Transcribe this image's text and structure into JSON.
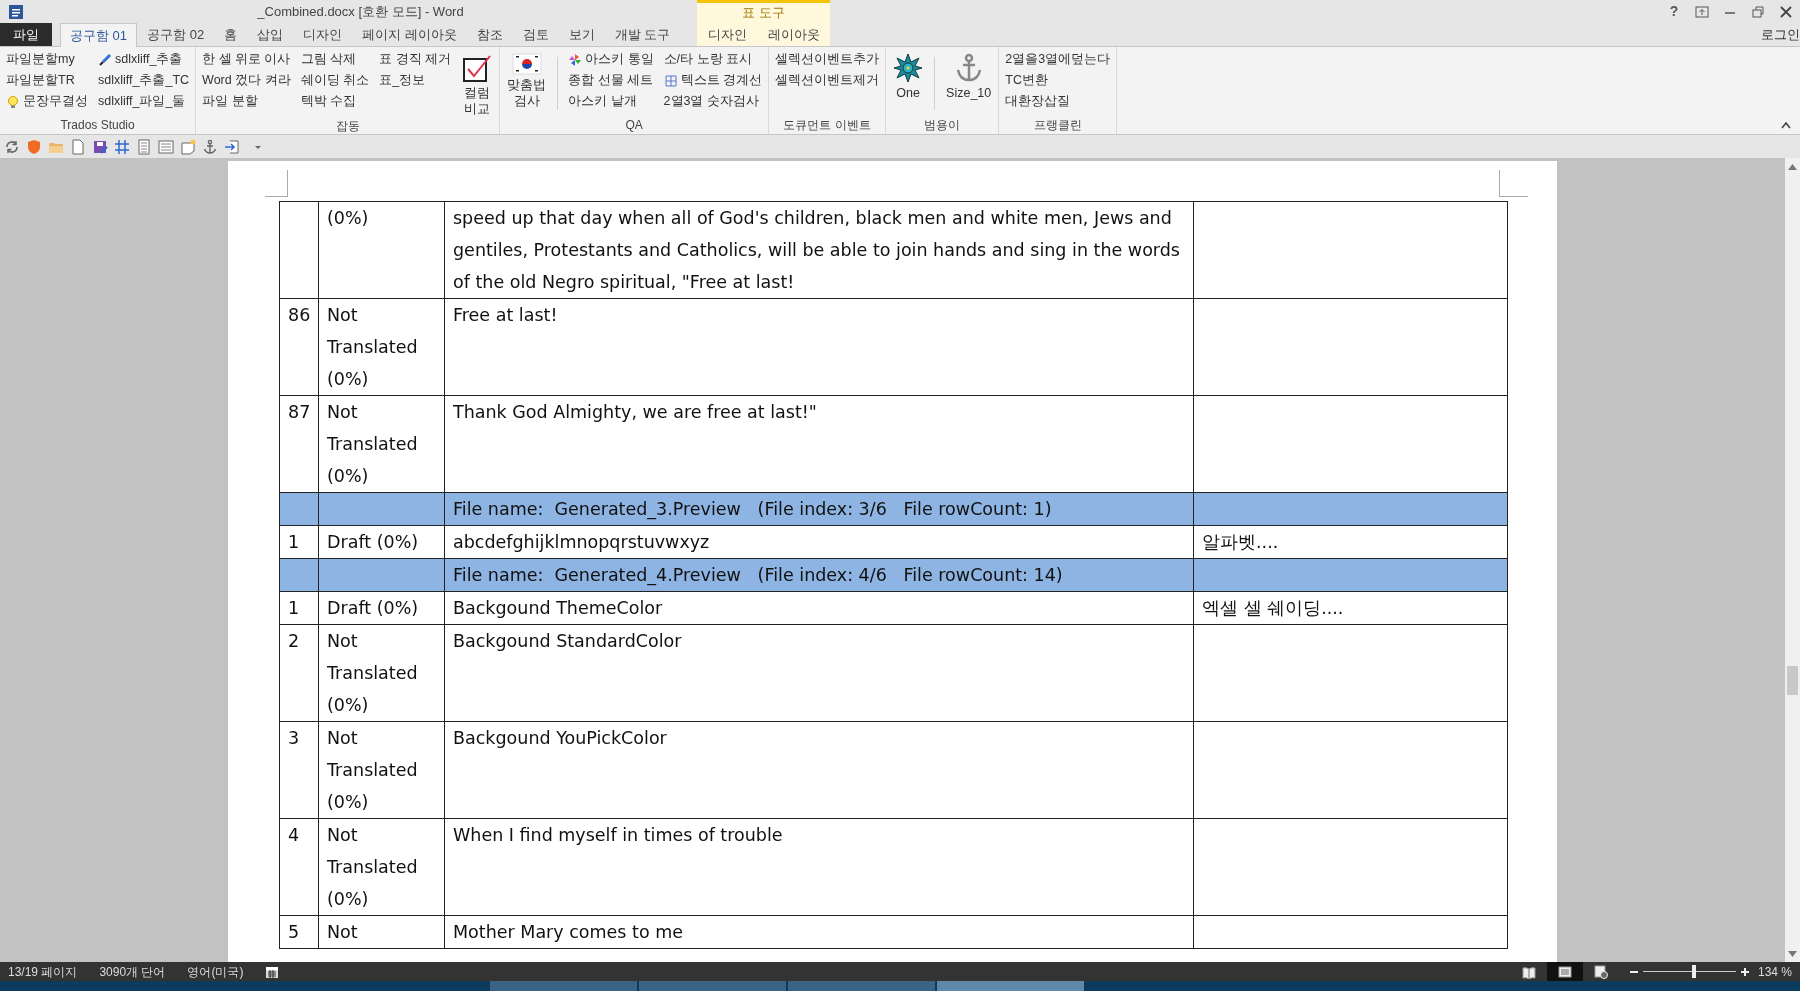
{
  "window": {
    "title": "_Combined.docx [호환 모드] - Word",
    "help": "?",
    "account": "로그인"
  },
  "tabs": [
    {
      "label": "파일",
      "kind": "file",
      "selected": false
    },
    {
      "label": "공구함 01",
      "kind": "tab",
      "selected": true
    },
    {
      "label": "공구함 02",
      "kind": "tab",
      "selected": false
    },
    {
      "label": "홈",
      "kind": "tab",
      "selected": false
    },
    {
      "label": "삽입",
      "kind": "tab",
      "selected": false
    },
    {
      "label": "디자인",
      "kind": "tab",
      "selected": false
    },
    {
      "label": "페이지 레이아웃",
      "kind": "tab",
      "selected": false
    },
    {
      "label": "참조",
      "kind": "tab",
      "selected": false
    },
    {
      "label": "검토",
      "kind": "tab",
      "selected": false
    },
    {
      "label": "보기",
      "kind": "tab",
      "selected": false
    },
    {
      "label": "개발 도구",
      "kind": "tab",
      "selected": false
    }
  ],
  "context_tabs": {
    "title": "표 도구",
    "tabs": [
      {
        "label": "디자인",
        "selected": false
      },
      {
        "label": "레이아웃",
        "selected": false
      }
    ]
  },
  "ribbon": [
    {
      "label": "Trados Studio",
      "blocks": [
        {
          "kind": "column",
          "buttons": [
            {
              "label": "파일분할my"
            },
            {
              "label": "파일분할TR"
            },
            {
              "label": "문장무결성"
            }
          ]
        },
        {
          "kind": "column",
          "buttons": [
            {
              "label": "sdlxliff_추출"
            },
            {
              "label": "sdlxliff_추출_TC"
            },
            {
              "label": "sdlxliff_파일_둘"
            }
          ]
        }
      ]
    },
    {
      "label": "잡동",
      "blocks": [
        {
          "kind": "column",
          "buttons": [
            {
              "label": "한 셀 위로 이사"
            },
            {
              "label": "Word 껐다 켜라"
            },
            {
              "label": "파일 분할"
            }
          ]
        },
        {
          "kind": "column",
          "buttons": [
            {
              "label": "그림 삭제"
            },
            {
              "label": "쉐이딩 취소"
            },
            {
              "label": "텍박 수집"
            }
          ]
        },
        {
          "kind": "column",
          "buttons": [
            {
              "label": "표 경직 제거"
            },
            {
              "label": "표_정보"
            }
          ]
        },
        {
          "kind": "large",
          "label": "컬럼 비교"
        }
      ]
    },
    {
      "label": "QA",
      "blocks": [
        {
          "kind": "large",
          "label": "맞춤법 검사"
        },
        {
          "kind": "separator"
        },
        {
          "kind": "column",
          "buttons": [
            {
              "label": "아스키 통일"
            },
            {
              "label": "종합 선물 세트"
            },
            {
              "label": "아스키 낱개"
            }
          ]
        },
        {
          "kind": "column",
          "buttons": [
            {
              "label": "소/타 노랑 표시"
            },
            {
              "label": "텍스트 경계선"
            },
            {
              "label": "2열3열 숫자검사"
            }
          ]
        }
      ]
    },
    {
      "label": "도큐먼트 이벤트",
      "blocks": [
        {
          "kind": "column",
          "buttons": [
            {
              "label": "셀렉션이벤트추가"
            },
            {
              "label": "셀렉션이벤트제거"
            }
          ]
        }
      ]
    },
    {
      "label": "범용이",
      "blocks": [
        {
          "kind": "large",
          "label": "One"
        },
        {
          "kind": "separator"
        },
        {
          "kind": "large",
          "label": "Size_10"
        }
      ]
    },
    {
      "label": "프랭클린",
      "blocks": [
        {
          "kind": "column",
          "buttons": [
            {
              "label": "2열을3열에덮는다"
            },
            {
              "label": "TC변환"
            },
            {
              "label": "대환장삽질"
            }
          ]
        }
      ]
    }
  ],
  "table": {
    "rows": [
      {
        "kind": "segment",
        "status": "(0%)",
        "source": "speed up that day when all of God's children, black men and white men, Jews and gentiles, Protestants and Catholics, will be able to join hands and sing in the words of the old Negro spiritual, \"Free at last!"
      },
      {
        "kind": "segment",
        "number": "86",
        "status": "Not Translated (0%)",
        "source": "Free at last!"
      },
      {
        "kind": "segment",
        "number": "87",
        "status": "Not Translated (0%)",
        "source": "Thank God Almighty, we are free at last!\""
      },
      {
        "kind": "file_header",
        "source": "File name:  Generated_3.Preview   (File index: 3/6   File rowCount: 1)"
      },
      {
        "kind": "segment",
        "number": "1",
        "status": "Draft (0%)",
        "source": "abcdefghijklmnopqrstuvwxyz",
        "target": "알파벳...."
      },
      {
        "kind": "file_header",
        "source": "File name:  Generated_4.Preview   (File index: 4/6   File rowCount: 14)"
      },
      {
        "kind": "segment",
        "number": "1",
        "status": "Draft (0%)",
        "source": "Backgound ThemeColor",
        "target": "엑셀 셀 쉐이딩...."
      },
      {
        "kind": "segment",
        "number": "2",
        "status": "Not Translated (0%)",
        "source": "Backgound StandardColor"
      },
      {
        "kind": "segment",
        "number": "3",
        "status": "Not Translated (0%)",
        "source": "Backgound YouPickColor"
      },
      {
        "kind": "segment",
        "number": "4",
        "status": "Not Translated (0%)",
        "source": "When I find myself in times of trouble"
      },
      {
        "kind": "segment",
        "number": "5",
        "status": "Not",
        "source": "Mother Mary comes to me"
      }
    ]
  },
  "status_bar": {
    "pages": "13/19 페이지",
    "words": "3090개 단어",
    "language": "영어(미국)",
    "views": [
      {
        "selected": false
      },
      {
        "selected": true
      },
      {
        "selected": false
      }
    ],
    "zoom": {
      "level": 0.55,
      "label": "134 %"
    }
  },
  "taskbar": {
    "buttons": [
      {
        "selected": false
      },
      {
        "selected": false
      },
      {
        "selected": false
      },
      {
        "selected": true
      }
    ]
  }
}
